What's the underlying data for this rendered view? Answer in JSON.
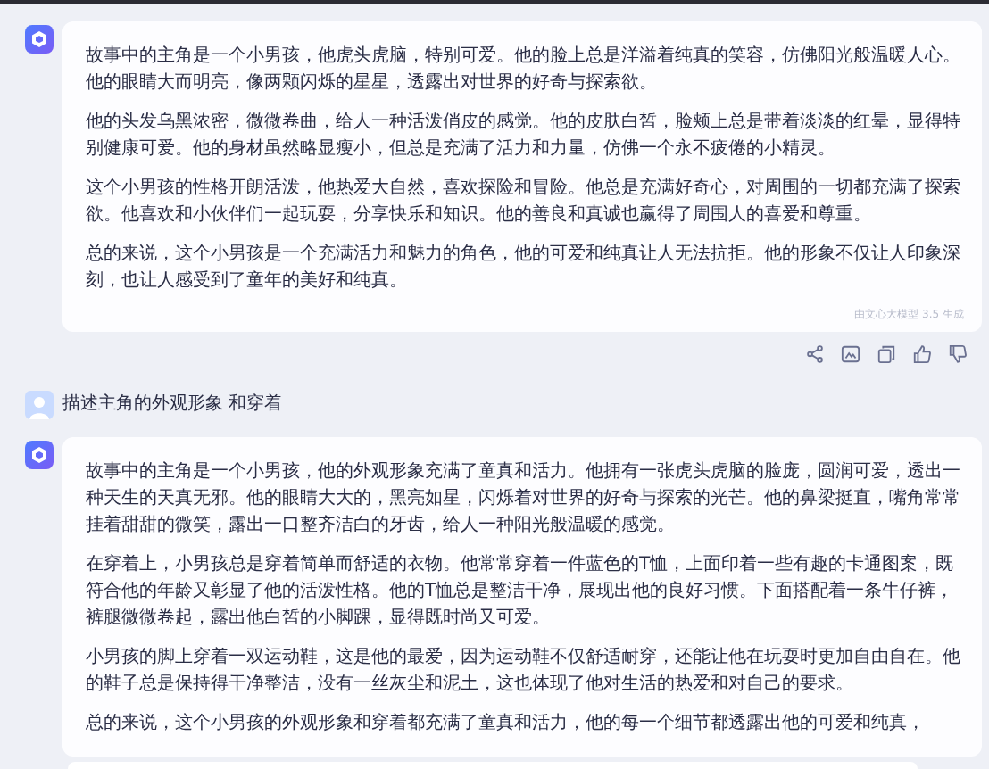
{
  "messages": [
    {
      "kind": "bot",
      "paragraphs": [
        "故事中的主角是一个小男孩，他虎头虎脑，特别可爱。他的脸上总是洋溢着纯真的笑容，仿佛阳光般温暖人心。他的眼睛大而明亮，像两颗闪烁的星星，透露出对世界的好奇与探索欲。",
        "他的头发乌黑浓密，微微卷曲，给人一种活泼俏皮的感觉。他的皮肤白皙，脸颊上总是带着淡淡的红晕，显得特别健康可爱。他的身材虽然略显瘦小，但总是充满了活力和力量，仿佛一个永不疲倦的小精灵。",
        "这个小男孩的性格开朗活泼，他热爱大自然，喜欢探险和冒险。他总是充满好奇心，对周围的一切都充满了探索欲。他喜欢和小伙伴们一起玩耍，分享快乐和知识。他的善良和真诚也赢得了周围人的喜爱和尊重。",
        "总的来说，这个小男孩是一个充满活力和魅力的角色，他的可爱和纯真让人无法抗拒。他的形象不仅让人印象深刻，也让人感受到了童年的美好和纯真。"
      ],
      "footer": "由文心大模型 3.5 生成",
      "show_actions": true
    },
    {
      "kind": "user",
      "text": "描述主角的外观形象 和穿着"
    },
    {
      "kind": "bot",
      "paragraphs": [
        "故事中的主角是一个小男孩，他的外观形象充满了童真和活力。他拥有一张虎头虎脑的脸庞，圆润可爱，透出一种天生的天真无邪。他的眼睛大大的，黑亮如星，闪烁着对世界的好奇与探索的光芒。他的鼻梁挺直，嘴角常常挂着甜甜的微笑，露出一口整齐洁白的牙齿，给人一种阳光般温暖的感觉。",
        "在穿着上，小男孩总是穿着简单而舒适的衣物。他常常穿着一件蓝色的T恤，上面印着一些有趣的卡通图案，既符合他的年龄又彰显了他的活泼性格。他的T恤总是整洁干净，展现出他的良好习惯。下面搭配着一条牛仔裤，裤腿微微卷起，露出他白皙的小脚踝，显得既时尚又可爱。",
        "小男孩的脚上穿着一双运动鞋，这是他的最爱，因为运动鞋不仅舒适耐穿，还能让他在玩耍时更加自由自在。他的鞋子总是保持得干净整洁，没有一丝灰尘和泥土，这也体现了他对生活的热爱和对自己的要求。",
        "总的来说，这个小男孩的外观形象和穿着都充满了童真和活力，他的每一个细节都透露出他的可爱和纯真，"
      ],
      "show_actions": false
    }
  ]
}
